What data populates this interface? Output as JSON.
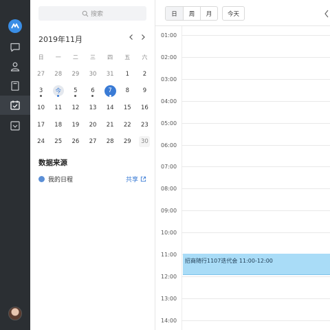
{
  "search": {
    "placeholder": "搜索"
  },
  "calendar": {
    "month_label": "2019年11月",
    "weekdays": [
      "日",
      "一",
      "二",
      "三",
      "四",
      "五",
      "六"
    ],
    "weeks": [
      [
        "27",
        "28",
        "29",
        "30",
        "31",
        "1",
        "2"
      ],
      [
        "3",
        "今",
        "5",
        "6",
        "7",
        "8",
        "9"
      ],
      [
        "10",
        "11",
        "12",
        "13",
        "14",
        "15",
        "16"
      ],
      [
        "17",
        "18",
        "19",
        "20",
        "21",
        "22",
        "23"
      ],
      [
        "24",
        "25",
        "26",
        "27",
        "28",
        "29",
        "30"
      ]
    ]
  },
  "sources": {
    "title": "数据来源",
    "items": [
      {
        "label": "我的日程",
        "action": "共享",
        "color": "#5b8fd6"
      }
    ]
  },
  "toolbar": {
    "views": [
      "日",
      "周",
      "月"
    ],
    "today": "今天"
  },
  "day_view": {
    "hours": [
      "01:00",
      "02:00",
      "03:00",
      "04:00",
      "05:00",
      "06:00",
      "07:00",
      "08:00",
      "09:00",
      "10:00",
      "11:00",
      "12:00",
      "13:00",
      "14:00"
    ],
    "event": {
      "label": "招商随行1107迭代会 11:00-12:00",
      "color": "#a9dcf7"
    }
  },
  "colors": {
    "accent": "#3a7bd5",
    "rail": "#2b2f33"
  },
  "icons": [
    "logo-icon",
    "chat-icon",
    "contacts-icon",
    "docs-icon",
    "calendar-icon",
    "inbox-icon",
    "search-icon",
    "chevron-left-icon",
    "chevron-right-icon",
    "external-link-icon"
  ]
}
